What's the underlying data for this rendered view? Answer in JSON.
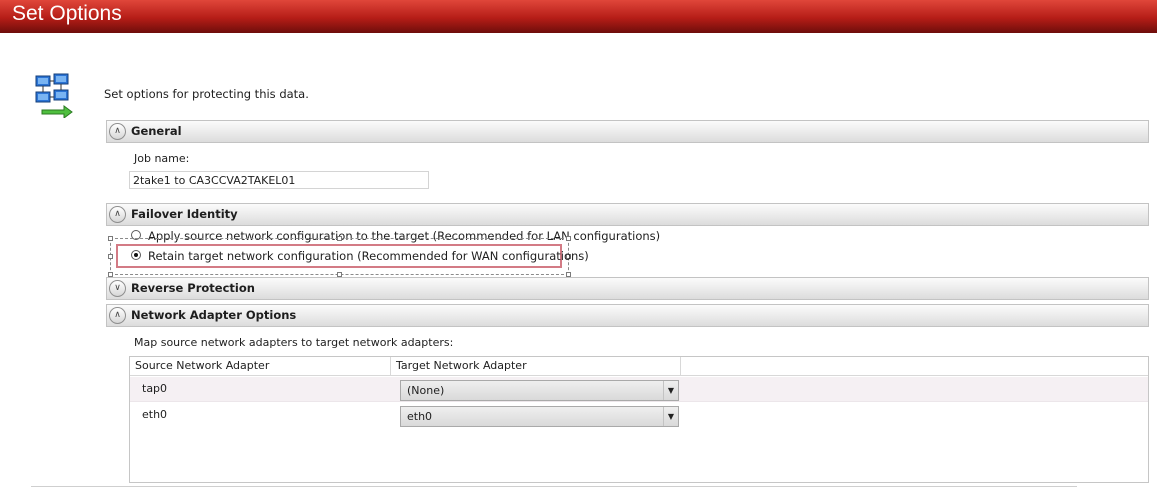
{
  "window": {
    "title": "Set Options"
  },
  "intro_text": "Set options for protecting this data.",
  "sections": {
    "general": {
      "label": "General",
      "expanded": true
    },
    "failover": {
      "label": "Failover Identity",
      "expanded": true
    },
    "reverse": {
      "label": "Reverse Protection",
      "expanded": false
    },
    "adapters": {
      "label": "Network Adapter Options",
      "expanded": true
    }
  },
  "general": {
    "job_name_label": "Job name:",
    "job_name_value": "2take1 to CA3CCVA2TAKEL01"
  },
  "failover": {
    "options": [
      {
        "label": "Apply source network configuration to the target (Recommended for LAN configurations)",
        "selected": false
      },
      {
        "label": "Retain target network configuration (Recommended for WAN configurations)",
        "selected": true
      }
    ]
  },
  "adapters": {
    "description": "Map source network adapters to target network adapters:",
    "columns": [
      "Source Network Adapter",
      "Target Network Adapter"
    ],
    "rows": [
      {
        "source": "tap0",
        "target": "(None)"
      },
      {
        "source": "eth0",
        "target": "eth0"
      }
    ]
  },
  "icons": {
    "app": "network-computers-icon",
    "expand": "chevron-up-icon",
    "collapse": "chevron-down-icon",
    "dropdown": "dropdown-arrow-icon"
  },
  "colors": {
    "title_bar": "#b51d17",
    "selection_outline": "#d37b85",
    "alt_row": "#f5f0f3"
  }
}
